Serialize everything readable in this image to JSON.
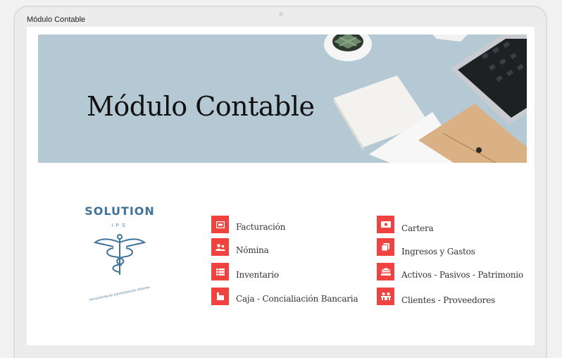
{
  "window": {
    "title": "Módulo Contable"
  },
  "hero": {
    "title": "Módulo Contable"
  },
  "logo": {
    "name": "SOLUTION",
    "sub": "IPS",
    "tagline": "Herramienta de administración eficiente"
  },
  "colors": {
    "accent": "#f0433f",
    "hero_bg": "#b5c9d4",
    "brand": "#40739a"
  },
  "menu": {
    "left": [
      {
        "label": "Facturación",
        "icon": "invoice-icon"
      },
      {
        "label": "Nómina",
        "icon": "users-icon"
      },
      {
        "label": "Inventario",
        "icon": "list-icon"
      },
      {
        "label": "Caja - Concialiación Bancaria",
        "icon": "cash-register-icon"
      }
    ],
    "right": [
      {
        "label": "Cartera",
        "icon": "money-bill-icon"
      },
      {
        "label": "Ingresos y Gastos",
        "icon": "copy-icon"
      },
      {
        "label": "Activos - Pasivos - Patrimonio",
        "icon": "balance-icon"
      },
      {
        "label": "Clientes - Proveedores",
        "icon": "people-icon"
      }
    ]
  }
}
